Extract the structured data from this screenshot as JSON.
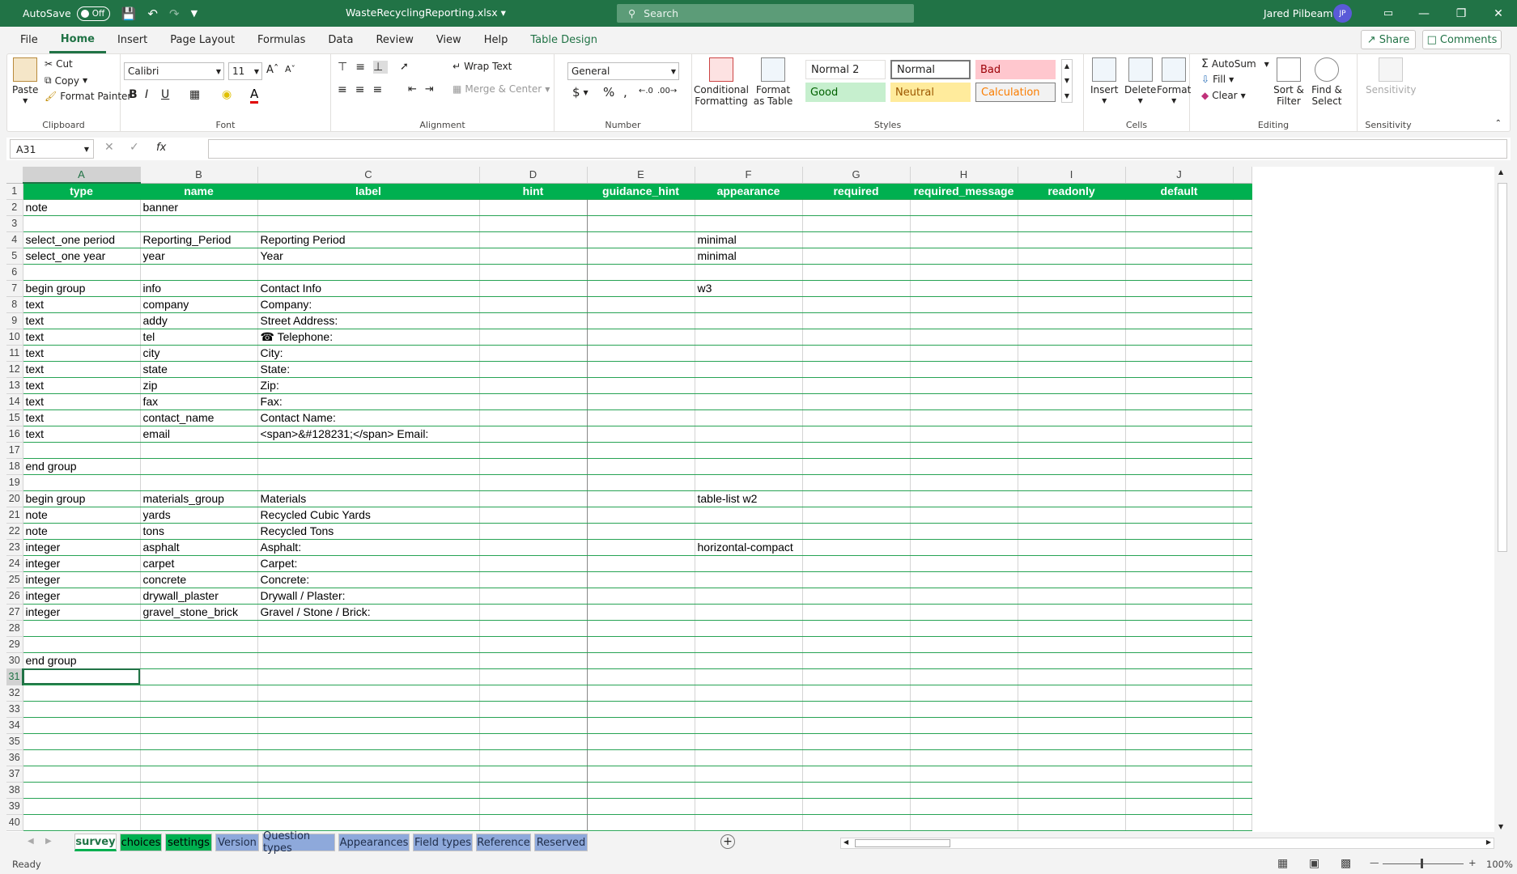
{
  "titlebar": {
    "autosave_label": "AutoSave",
    "autosave_state": "Off",
    "filename": "WasteRecyclingReporting.xlsx",
    "search_placeholder": "Search",
    "user_name": "Jared Pilbeam",
    "user_initials": "JP"
  },
  "menu": {
    "tabs": [
      "File",
      "Home",
      "Insert",
      "Page Layout",
      "Formulas",
      "Data",
      "Review",
      "View",
      "Help",
      "Table Design"
    ],
    "share": "Share",
    "comments": "Comments"
  },
  "ribbon": {
    "clipboard": {
      "label": "Clipboard",
      "paste": "Paste",
      "cut": "Cut",
      "copy": "Copy",
      "format_painter": "Format Painter"
    },
    "font": {
      "label": "Font",
      "font_name": "Calibri",
      "font_size": "11"
    },
    "alignment": {
      "label": "Alignment",
      "wrap_text": "Wrap Text",
      "merge_center": "Merge & Center"
    },
    "number": {
      "label": "Number",
      "format": "General"
    },
    "styles": {
      "label": "Styles",
      "conditional_formatting": "Conditional Formatting",
      "format_as_table": "Format as Table",
      "normal2": "Normal 2",
      "normal": "Normal",
      "bad": "Bad",
      "good": "Good",
      "neutral": "Neutral",
      "calculation": "Calculation"
    },
    "cells": {
      "label": "Cells",
      "insert": "Insert",
      "delete": "Delete",
      "format": "Format"
    },
    "editing": {
      "label": "Editing",
      "autosum": "AutoSum",
      "fill": "Fill",
      "clear": "Clear",
      "sort_filter": "Sort & Filter",
      "find_select": "Find & Select"
    },
    "sensitivity": {
      "label": "Sensitivity",
      "button": "Sensitivity"
    }
  },
  "formula_bar": {
    "name_box": "A31",
    "fx": "fx",
    "content": ""
  },
  "columns": [
    "A",
    "B",
    "C",
    "D",
    "E",
    "F",
    "G",
    "H",
    "I",
    "J"
  ],
  "rows": [
    [
      "type",
      "name",
      "label",
      "hint",
      "guidance_hint",
      "appearance",
      "required",
      "required_message",
      "readonly",
      "default"
    ],
    [
      "note",
      "banner",
      "",
      "",
      "",
      "",
      "",
      "",
      "",
      ""
    ],
    [
      "",
      "",
      "",
      "",
      "",
      "",
      "",
      "",
      "",
      ""
    ],
    [
      "select_one period",
      "Reporting_Period",
      "Reporting Period",
      "",
      "",
      "minimal",
      "",
      "",
      "",
      ""
    ],
    [
      "select_one year",
      "year",
      "Year",
      "",
      "",
      "minimal",
      "",
      "",
      "",
      ""
    ],
    [
      "",
      "",
      "",
      "",
      "",
      "",
      "",
      "",
      "",
      ""
    ],
    [
      "begin group",
      "info",
      "Contact Info",
      "",
      "",
      "w3",
      "",
      "",
      "",
      ""
    ],
    [
      "text",
      "company",
      "Company:",
      "",
      "",
      "",
      "",
      "",
      "",
      ""
    ],
    [
      "text",
      "addy",
      "Street Address:",
      "",
      "",
      "",
      "",
      "",
      "",
      ""
    ],
    [
      "text",
      "tel",
      "☎ Telephone:",
      "",
      "",
      "",
      "",
      "",
      "",
      ""
    ],
    [
      "text",
      "city",
      "City:",
      "",
      "",
      "",
      "",
      "",
      "",
      ""
    ],
    [
      "text",
      "state",
      "State:",
      "",
      "",
      "",
      "",
      "",
      "",
      ""
    ],
    [
      "text",
      "zip",
      "Zip:",
      "",
      "",
      "",
      "",
      "",
      "",
      ""
    ],
    [
      "text",
      "fax",
      "Fax:",
      "",
      "",
      "",
      "",
      "",
      "",
      ""
    ],
    [
      "text",
      "contact_name",
      "Contact Name:",
      "",
      "",
      "",
      "",
      "",
      "",
      ""
    ],
    [
      "text",
      "email",
      "<span>&#128231;</span> Email:",
      "",
      "",
      "",
      "",
      "",
      "",
      ""
    ],
    [
      "",
      "",
      "",
      "",
      "",
      "",
      "",
      "",
      "",
      ""
    ],
    [
      "end group",
      "",
      "",
      "",
      "",
      "",
      "",
      "",
      "",
      ""
    ],
    [
      "",
      "",
      "",
      "",
      "",
      "",
      "",
      "",
      "",
      ""
    ],
    [
      "begin group",
      "materials_group",
      "Materials",
      "",
      "",
      "table-list w2",
      "",
      "",
      "",
      ""
    ],
    [
      "note",
      "yards",
      "Recycled Cubic Yards",
      "",
      "",
      "",
      "",
      "",
      "",
      ""
    ],
    [
      "note",
      "tons",
      "Recycled Tons",
      "",
      "",
      "",
      "",
      "",
      "",
      ""
    ],
    [
      "integer",
      "asphalt",
      "Asphalt:",
      "",
      "",
      "horizontal-compact",
      "",
      "",
      "",
      ""
    ],
    [
      "integer",
      "carpet",
      "Carpet:",
      "",
      "",
      "",
      "",
      "",
      "",
      ""
    ],
    [
      "integer",
      "concrete",
      "Concrete:",
      "",
      "",
      "",
      "",
      "",
      "",
      ""
    ],
    [
      "integer",
      "drywall_plaster",
      "Drywall / Plaster:",
      "",
      "",
      "",
      "",
      "",
      "",
      ""
    ],
    [
      "integer",
      "gravel_stone_brick",
      "Gravel / Stone / Brick:",
      "",
      "",
      "",
      "",
      "",
      "",
      ""
    ],
    [
      "",
      "",
      "",
      "",
      "",
      "",
      "",
      "",
      "",
      ""
    ],
    [
      "",
      "",
      "",
      "",
      "",
      "",
      "",
      "",
      "",
      ""
    ],
    [
      "end group",
      "",
      "",
      "",
      "",
      "",
      "",
      "",
      "",
      ""
    ],
    [
      "",
      "",
      "",
      "",
      "",
      "",
      "",
      "",
      "",
      ""
    ],
    [
      "",
      "",
      "",
      "",
      "",
      "",
      "",
      "",
      "",
      ""
    ],
    [
      "",
      "",
      "",
      "",
      "",
      "",
      "",
      "",
      "",
      ""
    ],
    [
      "",
      "",
      "",
      "",
      "",
      "",
      "",
      "",
      "",
      ""
    ],
    [
      "",
      "",
      "",
      "",
      "",
      "",
      "",
      "",
      "",
      ""
    ],
    [
      "",
      "",
      "",
      "",
      "",
      "",
      "",
      "",
      "",
      ""
    ],
    [
      "",
      "",
      "",
      "",
      "",
      "",
      "",
      "",
      "",
      ""
    ],
    [
      "",
      "",
      "",
      "",
      "",
      "",
      "",
      "",
      "",
      ""
    ],
    [
      "",
      "",
      "",
      "",
      "",
      "",
      "",
      "",
      "",
      ""
    ],
    [
      "",
      "",
      "",
      "",
      "",
      "",
      "",
      "",
      "",
      ""
    ]
  ],
  "active_cell": "A31",
  "sheet_tabs": [
    {
      "label": "survey",
      "color": "green",
      "active": true
    },
    {
      "label": "choices",
      "color": "green"
    },
    {
      "label": "settings",
      "color": "green"
    },
    {
      "label": "Version",
      "color": "blue"
    },
    {
      "label": "Question types",
      "color": "blue"
    },
    {
      "label": "Appearances",
      "color": "blue"
    },
    {
      "label": "Field types",
      "color": "blue"
    },
    {
      "label": "Reference",
      "color": "blue"
    },
    {
      "label": "Reserved",
      "color": "blue"
    }
  ],
  "status": {
    "ready": "Ready",
    "zoom": "100%"
  },
  "colors": {
    "excel_green": "#217346",
    "header_fill": "#00b050",
    "tab_blue": "#8ea9db"
  }
}
